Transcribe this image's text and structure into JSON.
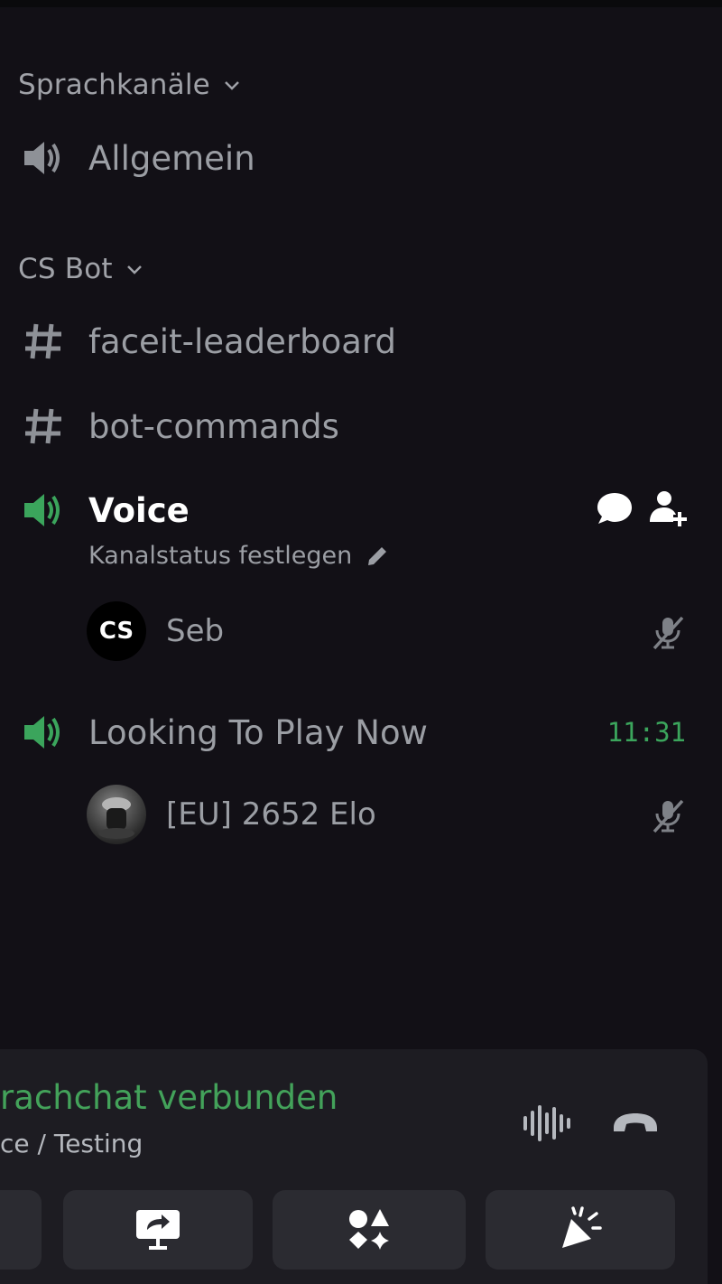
{
  "categories": {
    "voice_channels": "Sprachkanäle",
    "cs_bot": "CS Bot"
  },
  "channels": {
    "allgemein": "Allgemein",
    "faceit": "faceit-leaderboard",
    "botcmds": "bot-commands",
    "voice": "Voice",
    "voice_status": "Kanalstatus festlegen",
    "ltp": "Looking To Play Now",
    "ltp_timer": "11:31"
  },
  "members": {
    "seb": {
      "initials": "CS",
      "name": "Seb"
    },
    "elo": {
      "name": "[EU] 2652 Elo"
    }
  },
  "voice_panel": {
    "title": "rachchat verbunden",
    "subtitle": "ce / Testing"
  },
  "icons": {
    "speaker": "speaker-icon",
    "hash": "hash-icon",
    "chat": "chat-bubble-icon",
    "add_user": "add-user-icon",
    "mute": "muted-mic-icon",
    "edit": "pencil-icon",
    "soundboard": "waveform-icon",
    "disconnect": "hangup-icon",
    "share": "screen-share-icon",
    "activities": "activities-icon",
    "effects": "soundboard-icon"
  },
  "colors": {
    "background": "#121016",
    "active_green": "#3ba55c",
    "text_muted": "#9b9ea4",
    "panel": "#1d1c22"
  }
}
